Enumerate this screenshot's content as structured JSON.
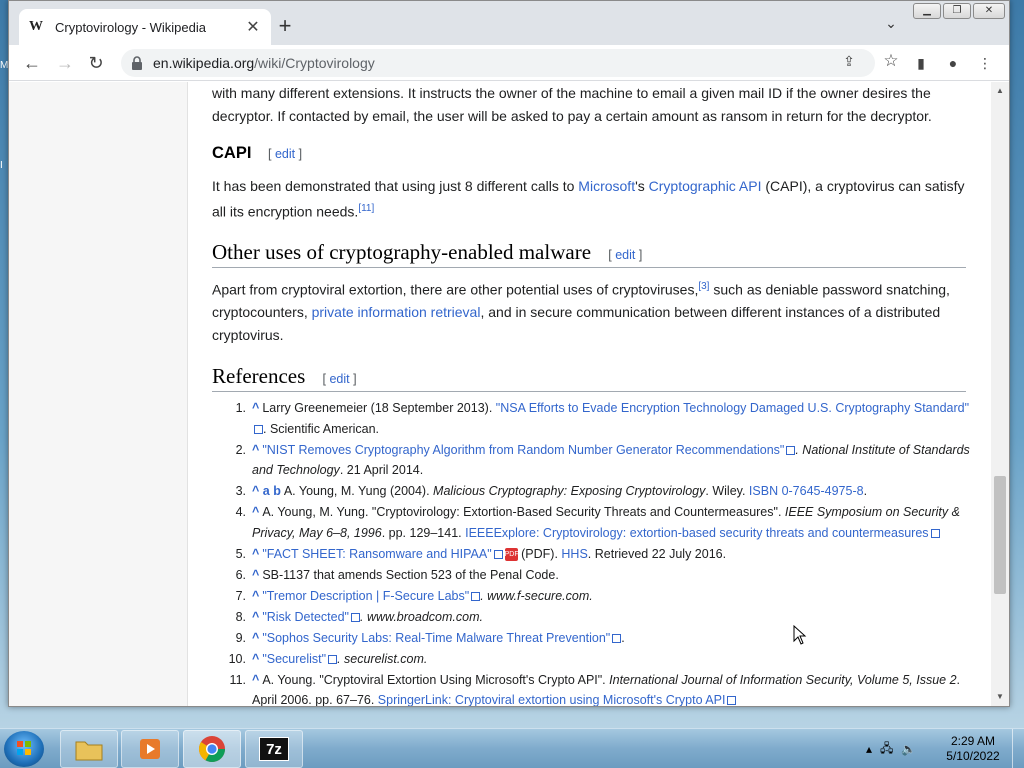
{
  "browser": {
    "tab_title": "Cryptovirology - Wikipedia",
    "tab_favicon": "W",
    "url_domain": "en.wikipedia.org",
    "url_path": "/wiki/Cryptovirology"
  },
  "article": {
    "para_top_1": "with many different extensions. It instructs the owner of the machine to email a given mail ID if the owner desires the",
    "para_top_2": "decryptor. If contacted by email, the user will be asked to pay a certain amount as ransom in return for the decryptor.",
    "capi_heading": "CAPI",
    "edit_label": "edit",
    "capi_text_1": "It has been demonstrated that using just 8 different calls to ",
    "capi_link_microsoft": "Microsoft",
    "capi_text_2": "'s ",
    "capi_link_api": "Cryptographic API",
    "capi_text_3": " (CAPI), a cryptovirus can satisfy",
    "capi_text_4": "all its encryption needs.",
    "capi_sup": "[11]",
    "other_heading": "Other uses of cryptography-enabled malware",
    "other_text_1": "Apart from cryptoviral extortion, there are other potential uses of cryptoviruses,",
    "other_sup": "[3]",
    "other_text_2": " such as deniable password snatching,",
    "other_text_3": "cryptocounters, ",
    "other_link_pir": "private information retrieval",
    "other_text_4": ", and in secure communication between different instances of a distributed",
    "other_text_5": "cryptovirus.",
    "references_heading": "References"
  },
  "references": [
    {
      "num": "1.",
      "caret": "^",
      "pre": "Larry Greenemeier (18 September 2013). ",
      "link": "\"NSA Efforts to Evade Encryption Technology Damaged U.S. Cryptography Standard\"",
      "post": ". Scientific American."
    },
    {
      "num": "2.",
      "caret": "^",
      "pre": "",
      "link": "\"NIST Removes Cryptography Algorithm from Random Number Generator Recommendations\"",
      "italic": ". National Institute of Standards and Technology",
      "post": ". 21 April 2014."
    },
    {
      "num": "3.",
      "caret": "^ a b",
      "pre": "A. Young, M. Yung (2004). ",
      "italic": "Malicious Cryptography: Exposing Cryptovirology",
      "post": ". Wiley. ",
      "link": "ISBN 0-7645-4975-8",
      "end": "."
    },
    {
      "num": "4.",
      "caret": "^",
      "pre": "A. Young, M. Yung. \"Cryptovirology: Extortion-Based Security Threats and Countermeasures\". ",
      "italic": "IEEE Symposium on Security & Privacy, May 6–8, 1996",
      "post": ". pp. 129–141. ",
      "link": "IEEEExplore: Cryptovirology: extortion-based security threats and countermeasures"
    },
    {
      "num": "5.",
      "caret": "^",
      "pre": "",
      "link": "\"FACT SHEET: Ransomware and HIPAA\"",
      "post": " (PDF). ",
      "link2": "HHS",
      "end": ". Retrieved 22 July 2016."
    },
    {
      "num": "6.",
      "caret": "^",
      "pre": "SB-1137 that amends Section 523 of the Penal Code."
    },
    {
      "num": "7.",
      "caret": "^",
      "pre": "",
      "link": "\"Tremor Description | F-Secure Labs\"",
      "italic": ". www.f-secure.com."
    },
    {
      "num": "8.",
      "caret": "^",
      "pre": "",
      "link": "\"Risk Detected\"",
      "italic": ". www.broadcom.com."
    },
    {
      "num": "9.",
      "caret": "^",
      "pre": "",
      "link": "\"Sophos Security Labs: Real-Time Malware Threat Prevention\"",
      "post": "."
    },
    {
      "num": "10.",
      "caret": "^",
      "pre": "",
      "link": "\"Securelist\"",
      "italic": ". securelist.com."
    },
    {
      "num": "11.",
      "caret": "^",
      "pre": "A. Young. \"Cryptoviral Extortion Using Microsoft's Crypto API\". ",
      "italic": "International Journal of Information Security, Volume 5, Issue 2",
      "post": ". April 2006. pp. 67–76. ",
      "link": "SpringerLink: Cryptoviral extortion using Microsoft's Crypto API"
    }
  ],
  "taskbar": {
    "time": "2:29 AM",
    "date": "5/10/2022",
    "sevenzip_label": "7z"
  },
  "colors": {
    "link": "#3366cc",
    "chrome_tabstrip": "#dfe3e8",
    "taskbar": "#7fabcc"
  }
}
